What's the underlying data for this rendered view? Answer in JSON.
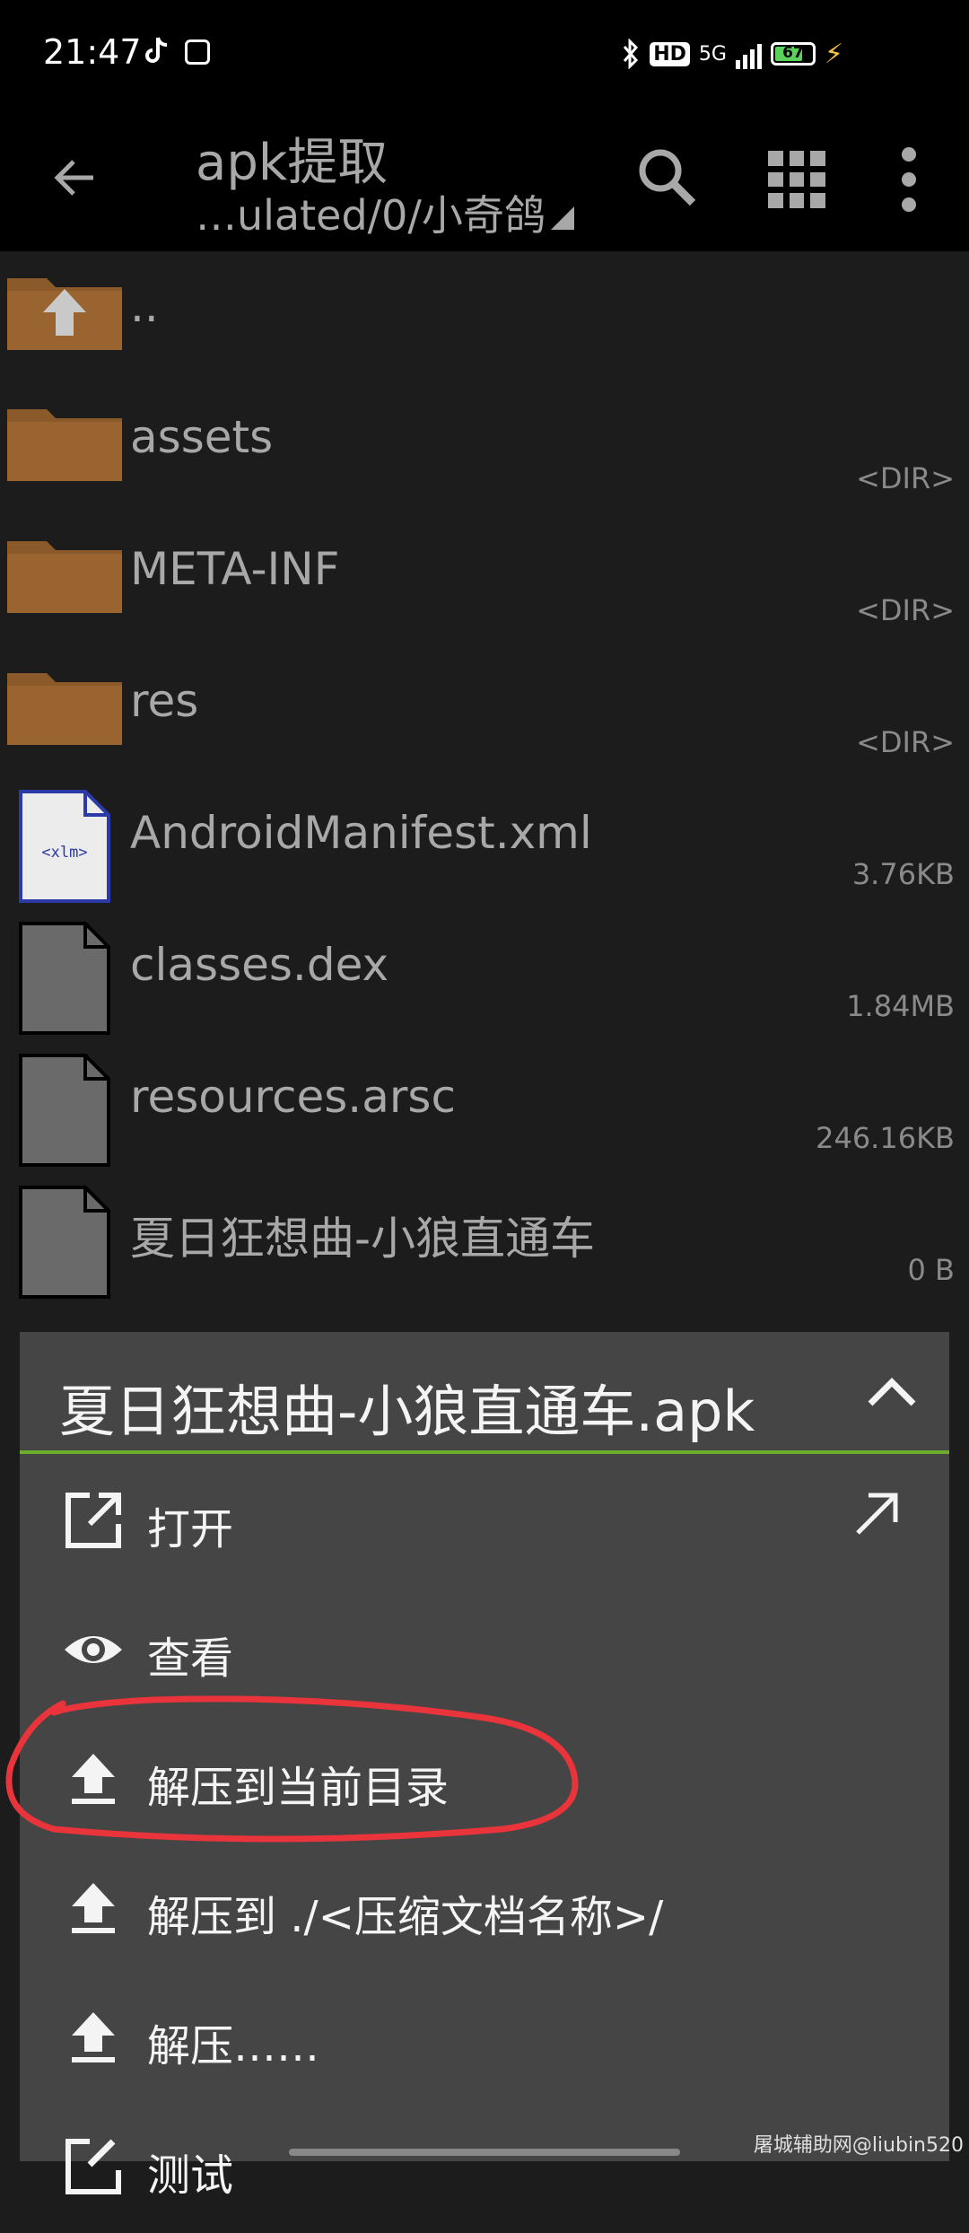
{
  "status_bar": {
    "time": "21:47",
    "hd_label": "HD",
    "network": "5G",
    "battery": "67"
  },
  "app_bar": {
    "title": "apk提取",
    "path": "…ulated/0/小奇鸽"
  },
  "files": [
    {
      "name": "..",
      "meta": "",
      "type": "folder-up"
    },
    {
      "name": "assets",
      "meta": "<DIR>",
      "type": "folder"
    },
    {
      "name": "META-INF",
      "meta": "<DIR>",
      "type": "folder"
    },
    {
      "name": "res",
      "meta": "<DIR>",
      "type": "folder"
    },
    {
      "name": "AndroidManifest.xml",
      "meta": "3.76KB",
      "type": "xml",
      "icon_text": "<xlm>"
    },
    {
      "name": "classes.dex",
      "meta": "1.84MB",
      "type": "file"
    },
    {
      "name": "resources.arsc",
      "meta": "246.16KB",
      "type": "file"
    },
    {
      "name": "夏日狂想曲-小狼直通车",
      "meta": "0 B",
      "type": "file"
    }
  ],
  "menu": {
    "title": "夏日狂想曲-小狼直通车.apk",
    "items": [
      {
        "label": "打开",
        "icon": "open-external-icon"
      },
      {
        "label": "查看",
        "icon": "eye-icon"
      },
      {
        "label": "解压到当前目录",
        "icon": "upload-icon"
      },
      {
        "label": "解压到 ./<压缩文档名称>/",
        "icon": "upload-icon"
      },
      {
        "label": "解压……",
        "icon": "upload-icon"
      },
      {
        "label": "测试",
        "icon": "edit-icon"
      }
    ]
  },
  "watermark": "屠城辅助网@liubin520",
  "colors": {
    "accent_underline": "#6cae2c",
    "folder": "#8b5a2b",
    "highlight_stroke": "#e8343a"
  }
}
